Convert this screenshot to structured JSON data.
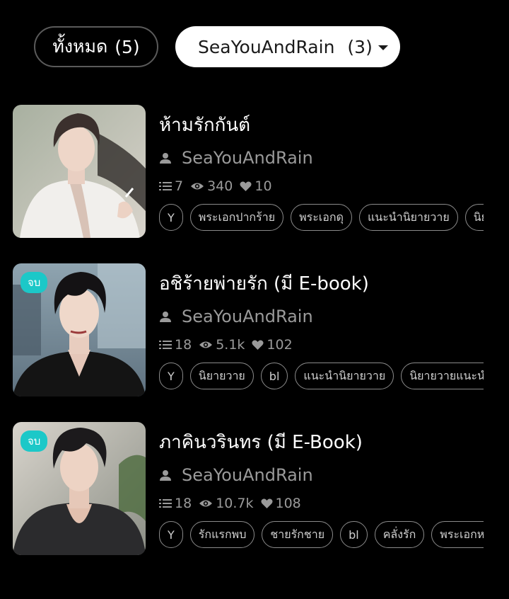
{
  "filters": {
    "all_label": "ทั้งหมด",
    "all_count": "(5)",
    "author_label": "SeaYouAndRain",
    "author_count": "(3)"
  },
  "colors": {
    "background": "#000000",
    "badge": "#1cc8c8",
    "muted_text": "#9a9a9a"
  },
  "stories": [
    {
      "title": "ห้ามรักกันต์",
      "author": "SeaYouAndRain",
      "chapters": "7",
      "views": "340",
      "likes": "10",
      "badge": "",
      "tags": [
        "Y",
        "พระเอกปากร้าย",
        "พระเอกดุ",
        "แนะนำนิยายวาย",
        "นิยายวาย"
      ]
    },
    {
      "title": "อชิร้ายพ่ายรัก (มี E-book)",
      "author": "SeaYouAndRain",
      "chapters": "18",
      "views": "5.1k",
      "likes": "102",
      "badge": "จบ",
      "tags": [
        "Y",
        "นิยายวาย",
        "bl",
        "แนะนำนิยายวาย",
        "นิยายวายแนะนำ"
      ]
    },
    {
      "title": "ภาคินวรินทร (มี E-Book)",
      "author": "SeaYouAndRain",
      "chapters": "18",
      "views": "10.7k",
      "likes": "108",
      "badge": "จบ",
      "tags": [
        "Y",
        "รักแรกพบ",
        "ชายรักชาย",
        "bl",
        "คลั่งรัก",
        "พระเอกหล่อ"
      ]
    }
  ]
}
